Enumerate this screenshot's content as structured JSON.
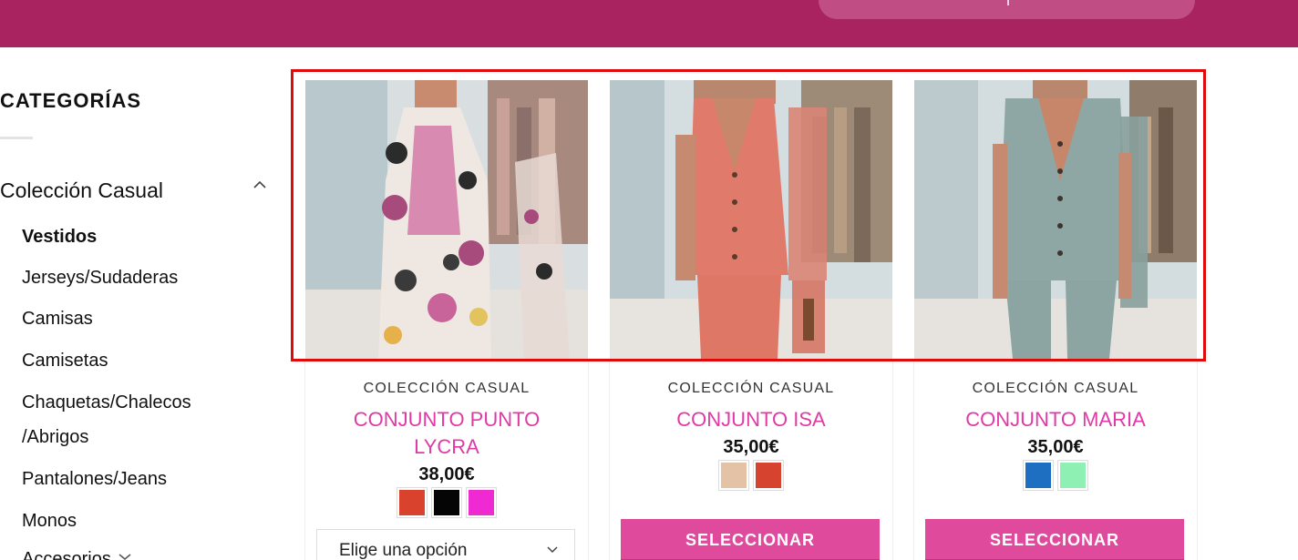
{
  "header": {
    "search_placeholder": ""
  },
  "sidebar": {
    "title": "CATEGORÍAS",
    "parent": "Colección Casual",
    "items": [
      {
        "label": "Vestidos",
        "active": true
      },
      {
        "label": "Jerseys/Sudaderas",
        "active": false
      },
      {
        "label": "Camisas",
        "active": false
      },
      {
        "label": "Camisetas",
        "active": false
      },
      {
        "label": "Chaquetas/Chalecos",
        "active": false
      },
      {
        "label": "/Abrigos",
        "active": false
      },
      {
        "label": "Pantalones/Jeans",
        "active": false
      },
      {
        "label": "Monos",
        "active": false
      },
      {
        "label": "Accesorios",
        "active": false
      }
    ]
  },
  "products": [
    {
      "category": "COLECCIÓN CASUAL",
      "name": "CONJUNTO PUNTO LYCRA",
      "price": "38,00€",
      "swatches": [
        "#d9432e",
        "#050505",
        "#f02ad3"
      ],
      "variant_placeholder": "Elige una opción"
    },
    {
      "category": "COLECCIÓN CASUAL",
      "name": "CONJUNTO ISA",
      "price": "35,00€",
      "swatches": [
        "#e3c2a5",
        "#d6432f"
      ],
      "button": "SELECCIONAR"
    },
    {
      "category": "COLECCIÓN CASUAL",
      "name": "CONJUNTO MARIA",
      "price": "35,00€",
      "swatches": [
        "#1e6fc2",
        "#8ef0b2"
      ],
      "button": "SELECCIONAR"
    }
  ],
  "colors": {
    "brand": "#a8235f",
    "accent": "#e04a9c",
    "product_name": "#e03aa7",
    "highlight": "#e10a0a"
  }
}
